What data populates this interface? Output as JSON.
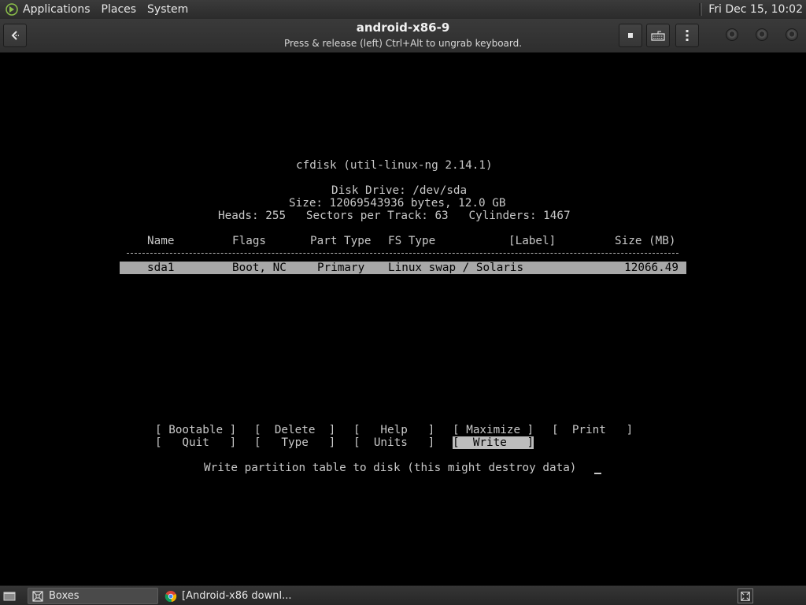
{
  "top_panel": {
    "menus": [
      "Applications",
      "Places",
      "System"
    ],
    "clock": "Fri Dec 15, 10:02"
  },
  "header_bar": {
    "title": "android-x86-9",
    "subtitle": "Press & release (left) Ctrl+Alt to ungrab keyboard."
  },
  "console": {
    "program_title": "cfdisk (util-linux-ng 2.14.1)",
    "disk_drive": "Disk Drive: /dev/sda",
    "disk_size": "Size: 12069543936 bytes, 12.0 GB",
    "disk_geometry": "Heads: 255   Sectors per Track: 63   Cylinders: 1467",
    "columns": {
      "name": "Name",
      "flags": "Flags",
      "part_type": "Part Type",
      "fs_type": "FS Type",
      "label": "[Label]",
      "size": "Size (MB)"
    },
    "partitions": [
      {
        "name": "sda1",
        "flags": "Boot, NC",
        "part_type": "Primary",
        "fs_type": "Linux swap / Solaris",
        "label": "",
        "size": "12066.49"
      }
    ],
    "commands": {
      "bootable": "[ Bootable ]",
      "delete": "[  Delete  ]",
      "help": "[   Help   ]",
      "maximize": "[ Maximize ]",
      "print": "[  Print   ]",
      "quit": "[   Quit   ]",
      "type": "[   Type   ]",
      "units": "[  Units   ]",
      "write": "[  Write   ]"
    },
    "selected_command": "write",
    "status_line": "Write partition table to disk (this might destroy data)"
  },
  "taskbar": {
    "tasks": [
      {
        "label": "Boxes",
        "icon": "boxes-icon",
        "active": true
      },
      {
        "label": "[Android-x86 downl...",
        "icon": "chrome-icon",
        "active": false
      }
    ]
  },
  "colors": {
    "panel_bg": "#2e2e2e",
    "console_bg": "#000000",
    "console_text": "#c8c8c8",
    "selection_bg": "#a8a8a8"
  }
}
